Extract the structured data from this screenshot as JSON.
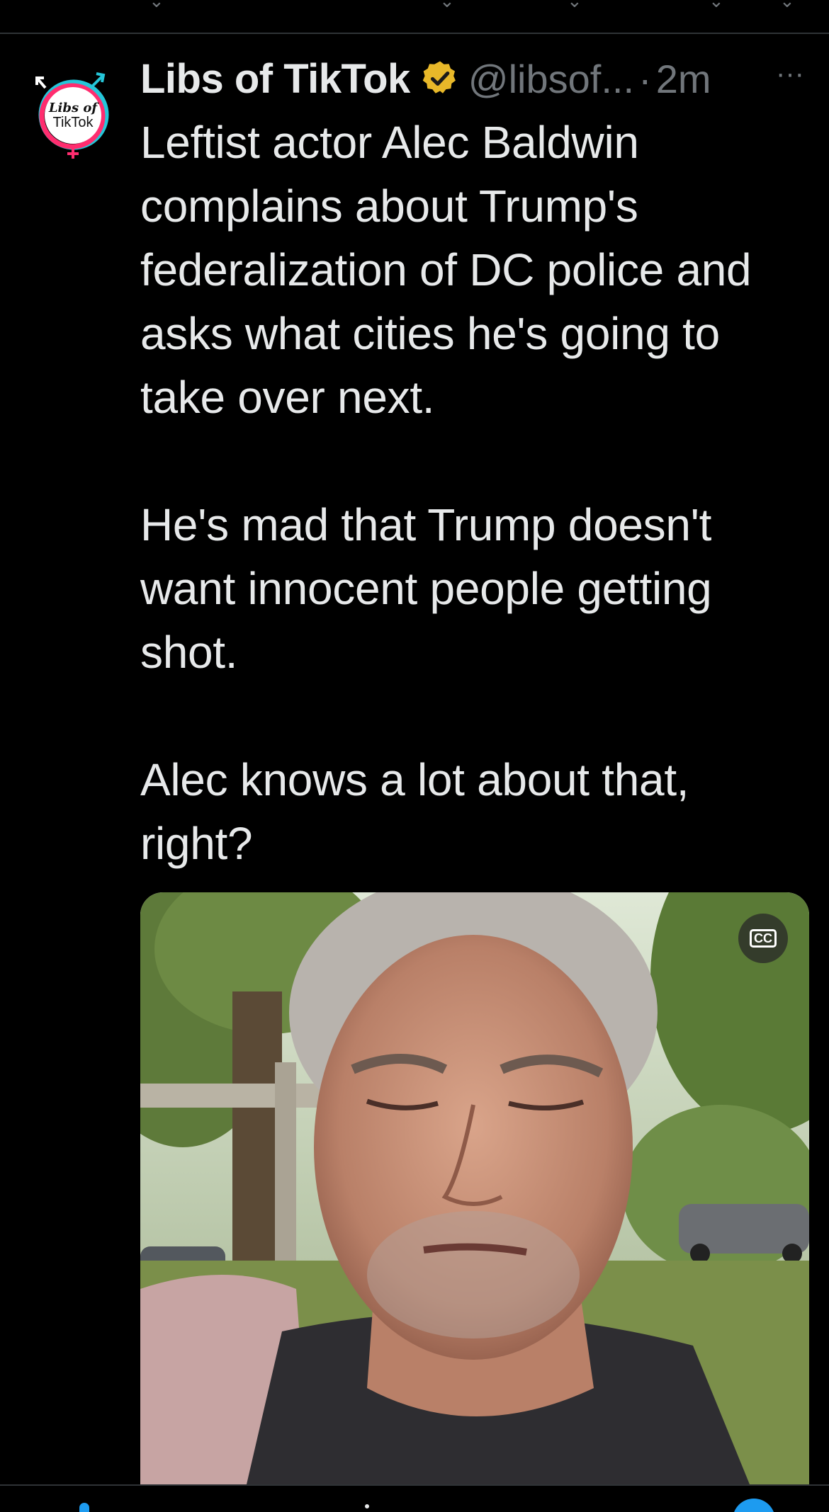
{
  "tweet": {
    "display_name": "Libs of TikTok",
    "handle": "@libsof...",
    "separator": "·",
    "timestamp": "2m",
    "more_label": "···",
    "verified_color": "#e8b829",
    "paragraphs": [
      "Leftist actor Alec Baldwin complains about Trump's federalization of DC police and asks what cities he's going to take over next.",
      "He's mad that Trump doesn't want innocent people getting shot.",
      "Alec knows a lot about that, right?"
    ]
  },
  "avatar": {
    "text_line1": "Libs of",
    "text_line2": "TikTok",
    "ring_colors": [
      "#25c6d9",
      "#ff2d6f"
    ]
  },
  "media": {
    "cc_label": "CC"
  },
  "colors": {
    "background": "#000000",
    "text_primary": "#e7e9ea",
    "text_secondary": "#71767b",
    "accent": "#1d9bf0",
    "divider": "#2f3336"
  }
}
